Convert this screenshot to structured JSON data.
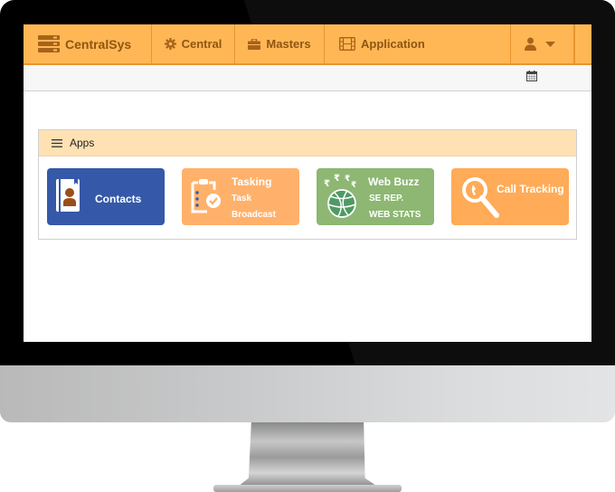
{
  "nav": {
    "brand": "CentralSys",
    "items": [
      {
        "label": "Central",
        "icon": "gear-icon"
      },
      {
        "label": "Masters",
        "icon": "briefcase-icon"
      },
      {
        "label": "Application",
        "icon": "film-icon"
      }
    ],
    "user_icon": "user-icon",
    "dropdown_icon": "caret-down-icon"
  },
  "subbar": {
    "icon": "calendar-icon"
  },
  "apps_panel": {
    "title": "Apps",
    "tiles": [
      {
        "title": "Contacts",
        "subs": [],
        "icon": "address-book-icon",
        "color": "#3559a8"
      },
      {
        "title": "Tasking",
        "subs": [
          "Task",
          "Broadcast"
        ],
        "icon": "clipboard-check-icon",
        "color": "#ffb16b"
      },
      {
        "title": "Web Buzz",
        "subs": [
          "SE REP.",
          "WEB STATS"
        ],
        "icon": "globe-rupee-icon",
        "color": "#8db772"
      },
      {
        "title": "Call Tracking",
        "subs": [],
        "icon": "phone-search-icon",
        "color": "#ffab57"
      }
    ]
  },
  "colors": {
    "nav_bg": "#ffb755",
    "nav_text": "#8f5512",
    "panel_head_bg": "#ffe1b3"
  }
}
